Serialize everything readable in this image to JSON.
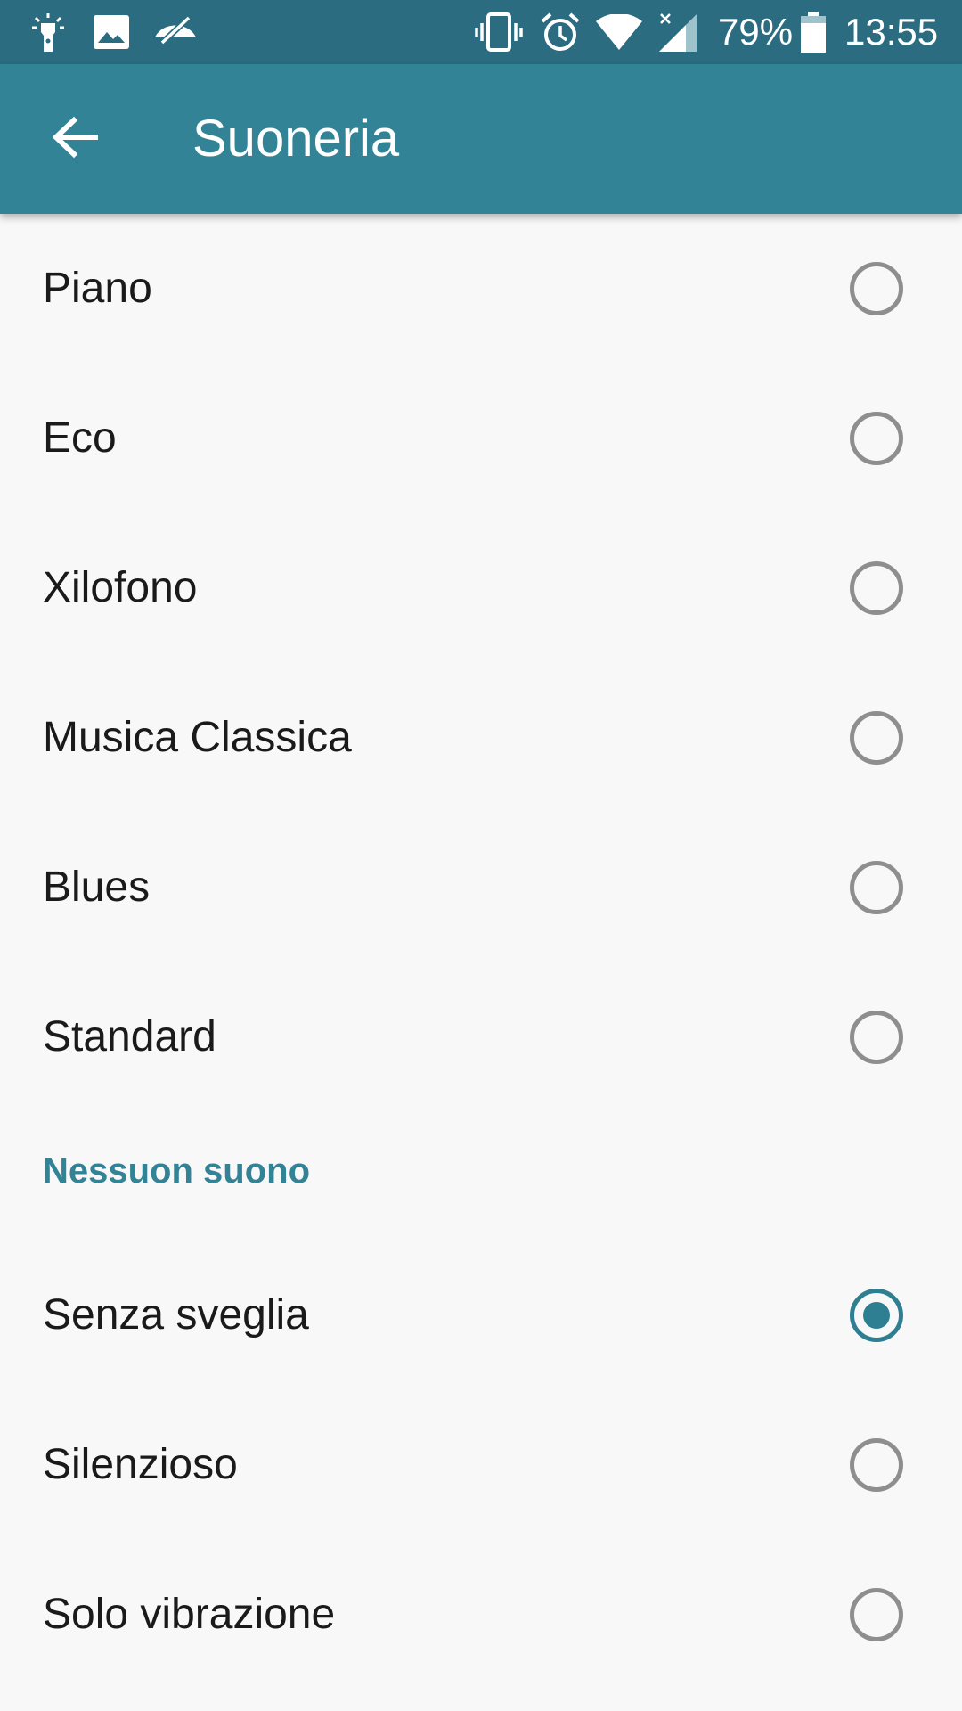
{
  "status_bar": {
    "battery": "79%",
    "time": "13:55",
    "left_icons": [
      "flashlight-icon",
      "image-icon",
      "eye-off-icon"
    ],
    "right_icons": [
      "vibrate-icon",
      "alarm-icon",
      "wifi-icon",
      "signal-icon",
      "battery-icon"
    ]
  },
  "app_bar": {
    "title": "Suoneria",
    "back_icon": "arrow-back-icon",
    "color": "#338396"
  },
  "ringtones": [
    {
      "label": "Piano",
      "selected": false
    },
    {
      "label": "Eco",
      "selected": false
    },
    {
      "label": "Xilofono",
      "selected": false
    },
    {
      "label": "Musica Classica",
      "selected": false
    },
    {
      "label": "Blues",
      "selected": false
    },
    {
      "label": "Standard",
      "selected": false
    }
  ],
  "no_sound_section": {
    "header": "Nessuon suono",
    "items": [
      {
        "label": "Senza sveglia",
        "selected": true
      },
      {
        "label": "Silenzioso",
        "selected": false
      },
      {
        "label": "Solo vibrazione",
        "selected": false
      }
    ]
  },
  "colors": {
    "accent": "#338396",
    "status_bar": "#2b6c80",
    "radio_unchecked": "#8e8e8e",
    "background": "#f8f8f8"
  }
}
